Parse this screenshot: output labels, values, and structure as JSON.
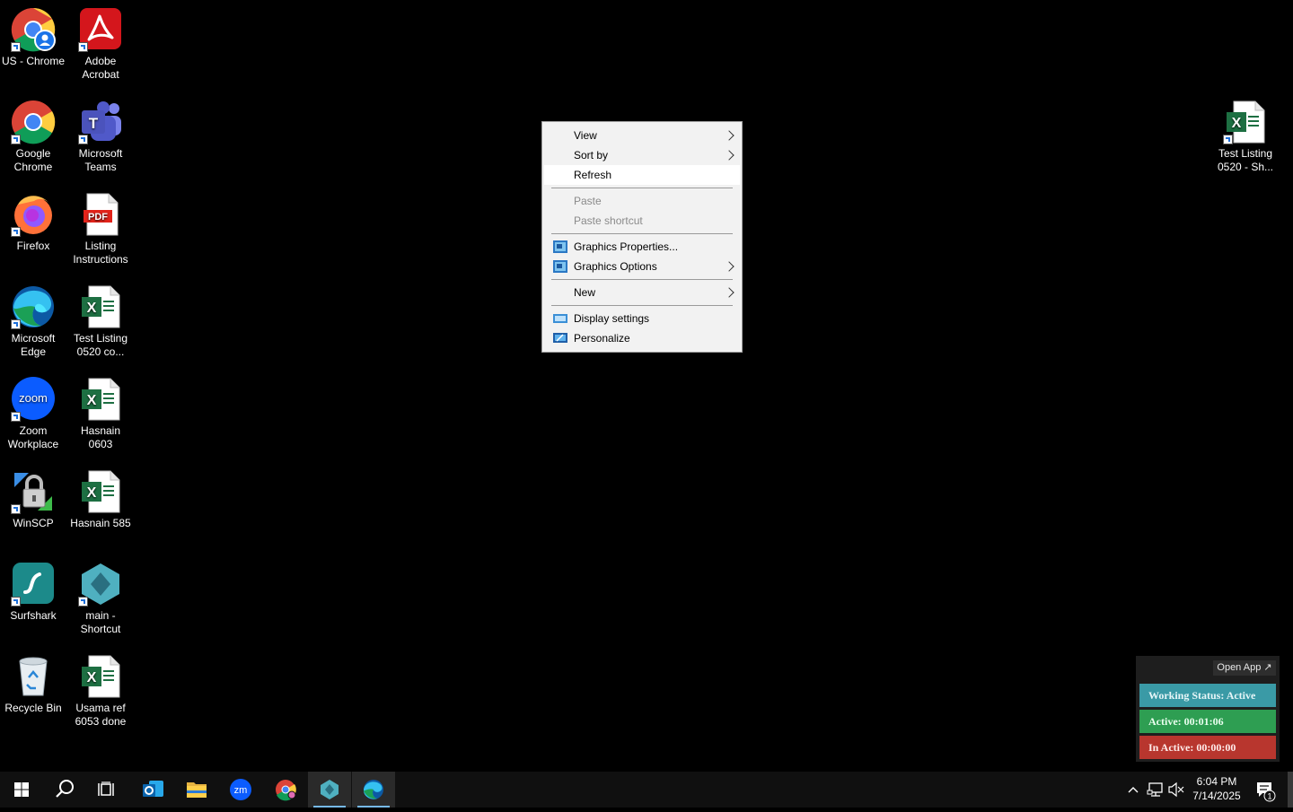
{
  "desktop": {
    "icons": [
      {
        "label": "US - Chrome",
        "icon": "chrome-profile-icon"
      },
      {
        "label": "Adobe Acrobat",
        "icon": "adobe-acrobat-icon"
      },
      {
        "label": "Google Chrome",
        "icon": "chrome-icon"
      },
      {
        "label": "Microsoft Teams",
        "icon": "teams-icon"
      },
      {
        "label": "Firefox",
        "icon": "firefox-icon"
      },
      {
        "label": "Listing Instructions",
        "icon": "pdf-file-icon"
      },
      {
        "label": "Microsoft Edge",
        "icon": "edge-icon"
      },
      {
        "label": "Test Listing 0520 co...",
        "icon": "excel-file-icon"
      },
      {
        "label": "Zoom Workplace",
        "icon": "zoom-icon"
      },
      {
        "label": "Hasnain 0603",
        "icon": "excel-file-icon"
      },
      {
        "label": "WinSCP",
        "icon": "winscp-icon"
      },
      {
        "label": "Hasnain 585",
        "icon": "excel-file-icon"
      },
      {
        "label": "Surfshark",
        "icon": "surfshark-icon"
      },
      {
        "label": "main - Shortcut",
        "icon": "app-cube-icon"
      },
      {
        "label": "Recycle Bin",
        "icon": "recycle-bin-icon"
      },
      {
        "label": "Usama ref 6053 done",
        "icon": "excel-file-icon"
      },
      {
        "label": "Test Listing 0520 - Sh...",
        "icon": "excel-file-icon"
      }
    ],
    "zoom_logo_text": "zoom",
    "pdf_badge": "PDF",
    "excel_letter": "X",
    "teams_letter": "T"
  },
  "context_menu": {
    "items": [
      {
        "label": "View",
        "submenu": true
      },
      {
        "label": "Sort by",
        "submenu": true
      },
      {
        "label": "Refresh",
        "highlighted": true
      },
      {
        "label": "Paste",
        "disabled": true
      },
      {
        "label": "Paste shortcut",
        "disabled": true
      },
      {
        "label": "Graphics Properties...",
        "icon": "intel-graphics-icon"
      },
      {
        "label": "Graphics Options",
        "icon": "intel-graphics-icon",
        "submenu": true
      },
      {
        "label": "New",
        "submenu": true
      },
      {
        "label": "Display settings",
        "icon": "display-settings-icon"
      },
      {
        "label": "Personalize",
        "icon": "personalize-icon"
      }
    ]
  },
  "status_widget": {
    "open_app": "Open App ↗",
    "working_status": "Working Status: Active",
    "active": "Active: 00:01:06",
    "inactive": "In Active: 00:00:00",
    "colors": {
      "working": "#3a9aa6",
      "active": "#2e9e52",
      "inactive": "#b8362e"
    }
  },
  "taskbar": {
    "buttons": [
      {
        "name": "start-button",
        "icon": "windows-logo-icon"
      },
      {
        "name": "search-button",
        "icon": "search-icon"
      },
      {
        "name": "task-view-button",
        "icon": "task-view-icon"
      },
      {
        "name": "outlook-button",
        "icon": "outlook-icon"
      },
      {
        "name": "file-explorer-button",
        "icon": "folder-icon"
      },
      {
        "name": "zoom-button",
        "icon": "zoom-icon"
      },
      {
        "name": "chrome-button",
        "icon": "chrome-icon"
      },
      {
        "name": "main-app-button",
        "icon": "app-cube-icon",
        "active": true
      },
      {
        "name": "edge-button",
        "icon": "edge-icon",
        "active": true
      }
    ],
    "zoom_text": "zm",
    "time": "6:04 PM",
    "date": "7/14/2025",
    "notification_count": "1"
  }
}
